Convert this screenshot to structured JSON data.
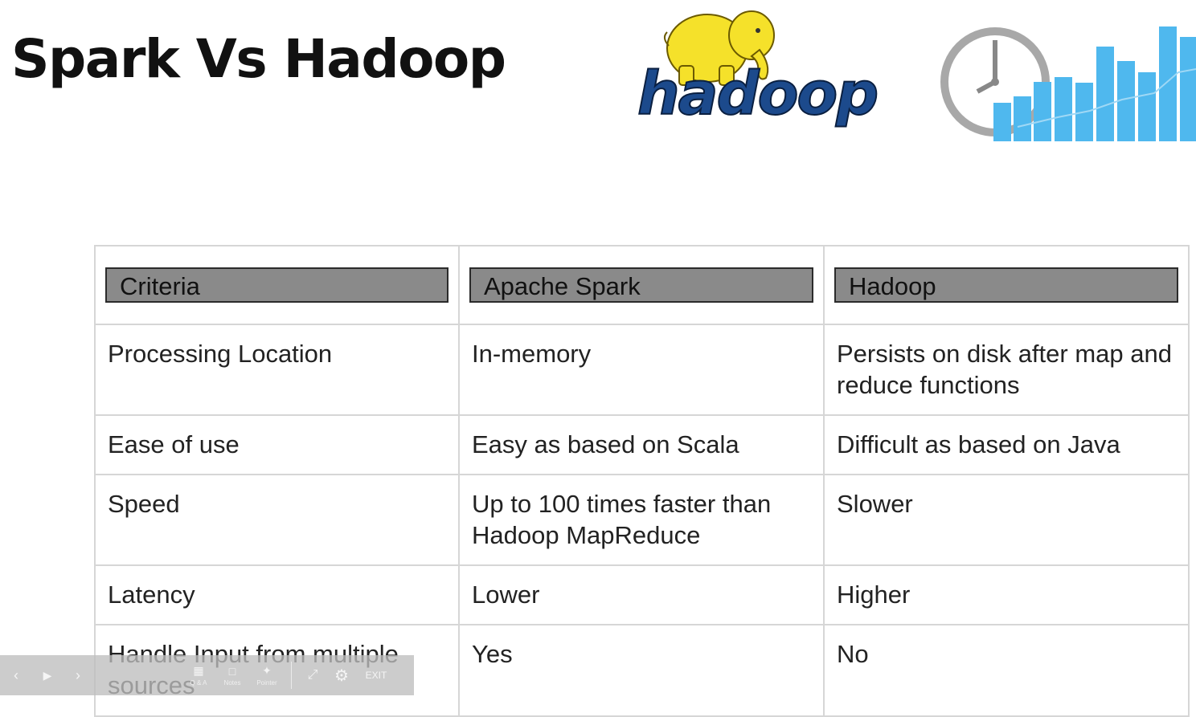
{
  "slide": {
    "title": "Spark Vs Hadoop",
    "logo_text": "hadoop"
  },
  "table": {
    "headers": [
      "Criteria",
      "Apache Spark",
      "Hadoop"
    ],
    "rows": [
      [
        "Processing Location",
        "In-memory",
        "Persists on disk after map and reduce functions"
      ],
      [
        "Ease of use",
        "Easy as based on Scala",
        "Difficult as based on Java"
      ],
      [
        "Speed",
        "Up to 100 times faster than Hadoop MapReduce",
        "Slower"
      ],
      [
        "Latency",
        "Lower",
        "Higher"
      ],
      [
        "Handle Input from multiple sources",
        "Yes",
        "No"
      ]
    ]
  },
  "toolbar": {
    "prev_icon": "chevron-left-icon",
    "play_icon": "play-icon",
    "next_icon": "chevron-right-icon",
    "qa_label": "Q & A",
    "notes_label": "Notes",
    "pointer_label": "Pointer",
    "exit_label": "EXIT"
  },
  "colors": {
    "header_fill": "#8a8a8a",
    "hadoop_blue": "#1c4a8c",
    "elephant_yellow": "#f5e12a",
    "chart_blue": "#4fb8ee"
  }
}
